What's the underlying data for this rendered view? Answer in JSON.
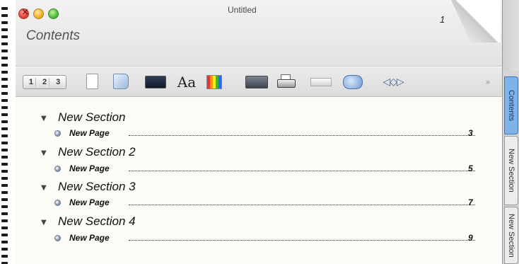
{
  "window": {
    "title": "Untitled"
  },
  "header": {
    "section_title": "Contents",
    "page_number": "1"
  },
  "toolbar": {
    "page_numbers": [
      "1",
      "2",
      "3"
    ],
    "font_label": "Aa",
    "nav_label": "◁◇▷",
    "overflow_label": "»"
  },
  "toc": {
    "sections": [
      {
        "title": "New Section",
        "pages": [
          {
            "label": "New Page",
            "number": "3"
          }
        ]
      },
      {
        "title": "New Section 2",
        "pages": [
          {
            "label": "New Page",
            "number": "5"
          }
        ]
      },
      {
        "title": "New Section 3",
        "pages": [
          {
            "label": "New Page",
            "number": "7"
          }
        ]
      },
      {
        "title": "New Section 4",
        "pages": [
          {
            "label": "New Page",
            "number": "9"
          }
        ]
      }
    ]
  },
  "side_tabs": [
    "Contents",
    "New Section",
    "New Section"
  ],
  "colors": {
    "active_tab": "#7fb2e6",
    "paper": "#fcfbf5",
    "toolbar": "#e0e0e0"
  }
}
